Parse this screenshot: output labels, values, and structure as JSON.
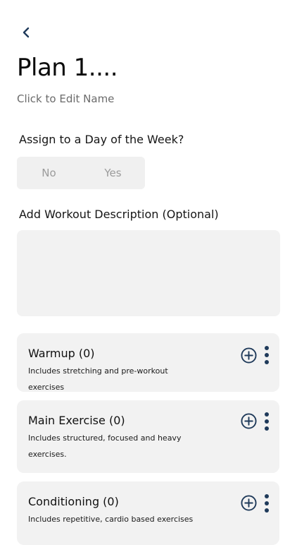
{
  "header": {
    "back_icon": "chevron-left-icon",
    "title": "Plan 1....",
    "subtitle": "Click to Edit Name"
  },
  "assign": {
    "label": "Assign to a Day of the Week?",
    "options": [
      "No",
      "Yes"
    ]
  },
  "description": {
    "label": "Add Workout Description (Optional)",
    "value": "",
    "placeholder": ""
  },
  "sections": [
    {
      "title": "Warmup (0)",
      "description": "Includes stretching and pre-workout exercises",
      "add_icon": "add-circle-icon",
      "more_icon": "more-vertical-icon"
    },
    {
      "title": "Main Exercise (0)",
      "description": "Includes structured, focused and heavy exercises.",
      "add_icon": "add-circle-icon",
      "more_icon": "more-vertical-icon"
    },
    {
      "title": "Conditioning (0)",
      "description": "Includes repetitive, cardio based exercises",
      "add_icon": "add-circle-icon",
      "more_icon": "more-vertical-icon"
    }
  ],
  "colors": {
    "accent": "#1f3a5a",
    "card_bg": "#f2f2f2",
    "muted_text": "#9b9b9b"
  }
}
